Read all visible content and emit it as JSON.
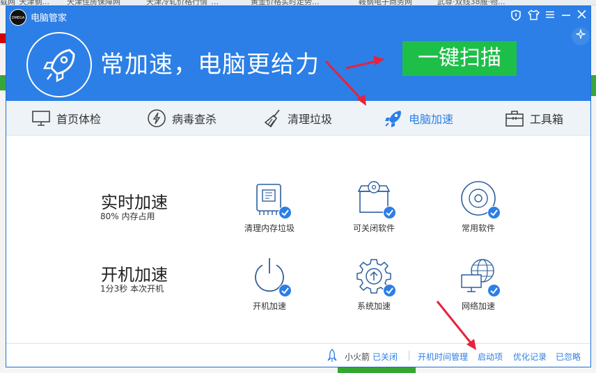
{
  "app": {
    "title": "电脑管家",
    "logo_text": "OMEGA",
    "window_controls": [
      "shield-icon",
      "shirt-icon",
      "menu-icon",
      "minimize-icon",
      "close-icon"
    ]
  },
  "hero": {
    "slogan": "常加速，电脑更给力",
    "scan_button": "一键扫描"
  },
  "tabs": [
    {
      "label": "首页体检",
      "icon": "monitor-icon"
    },
    {
      "label": "病毒查杀",
      "icon": "lightning-icon"
    },
    {
      "label": "清理垃圾",
      "icon": "broom-icon"
    },
    {
      "label": "电脑加速",
      "icon": "rocket-icon",
      "active": true
    },
    {
      "label": "工具箱",
      "icon": "toolbox-icon"
    }
  ],
  "sections": [
    {
      "title": "实时加速",
      "subtitle": "80% 内存占用",
      "items": [
        {
          "label": "清理内存垃圾",
          "icon": "memory-chip-icon"
        },
        {
          "label": "可关闭软件",
          "icon": "software-box-icon"
        },
        {
          "label": "常用软件",
          "icon": "disc-icon"
        }
      ]
    },
    {
      "title": "开机加速",
      "subtitle": "1分3秒 本次开机",
      "items": [
        {
          "label": "开机加速",
          "icon": "power-icon"
        },
        {
          "label": "系统加速",
          "icon": "gear-icon"
        },
        {
          "label": "网络加速",
          "icon": "globe-monitor-icon"
        }
      ]
    }
  ],
  "footer": {
    "rocket_label": "小火箭",
    "rocket_status": "已关闭",
    "links": [
      "开机时间管理",
      "启动项",
      "优化记录",
      "已忽略"
    ]
  },
  "background": {
    "tabs": [
      "载网_天津钢...",
      "天津佳房保障网",
      "天津冷轧价格行情_...",
      "黄金价格实时走势...",
      "鞍钢电子商务网",
      "武尊·双线38服·物..."
    ]
  },
  "colors": {
    "primary": "#2c7fe6",
    "scan_button": "#1ebf48",
    "annotation_arrow": "#e8223a"
  }
}
